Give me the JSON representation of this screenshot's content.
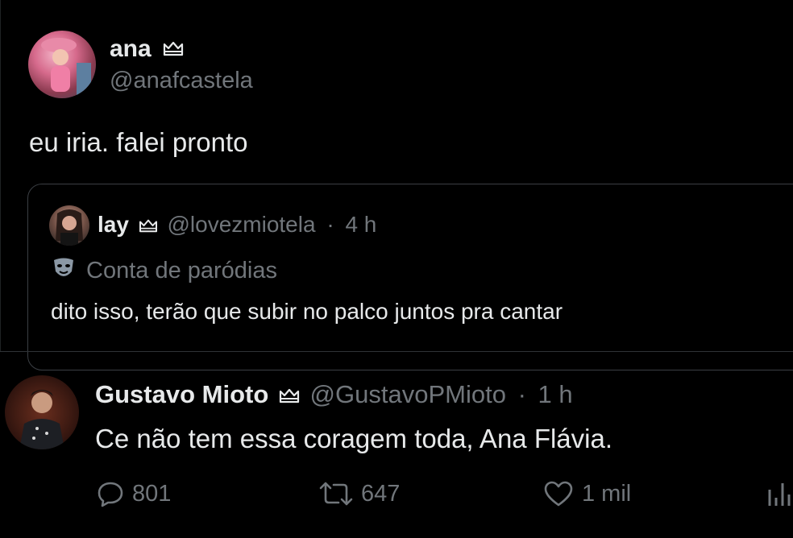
{
  "main_tweet": {
    "author_name": "ana",
    "author_handle": "@anafcastela",
    "text": "eu iria. falei pronto"
  },
  "quoted_tweet": {
    "author_name": "lay",
    "author_handle": "@lovezmiotela",
    "separator": "·",
    "time": "4 h",
    "label": "Conta de paródias",
    "text": "dito isso, terão que subir no palco juntos pra cantar"
  },
  "reply_tweet": {
    "author_name": "Gustavo Mioto",
    "author_handle": "@GustavoPMioto",
    "separator": "·",
    "time": "1 h",
    "text": "Ce não tem essa coragem toda, Ana Flávia.",
    "actions": {
      "replies": "801",
      "reposts": "647",
      "likes": "1 mil"
    }
  },
  "colors": {
    "background": "#000000",
    "text": "#e7e9ea",
    "muted": "#71767b",
    "border": "#3b3f44"
  },
  "icons": [
    "crown-badge-icon",
    "parody-mask-icon",
    "reply-icon",
    "repost-icon",
    "like-icon",
    "views-icon"
  ]
}
